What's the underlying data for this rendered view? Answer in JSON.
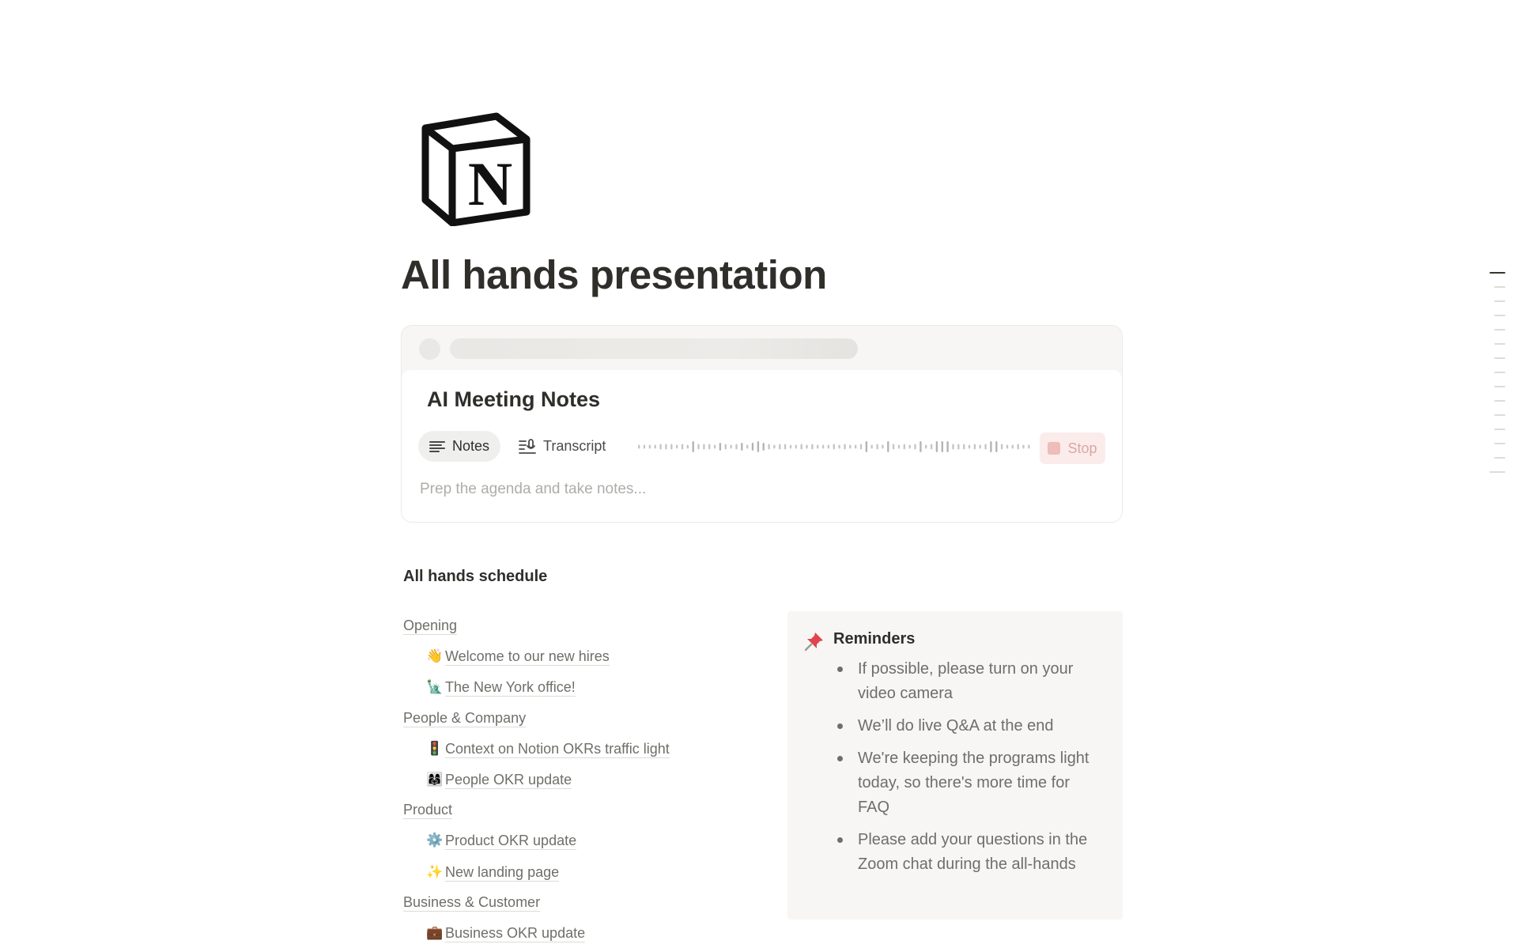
{
  "page": {
    "title": "All hands presentation",
    "icon": "notion-logo-icon"
  },
  "ai_notes": {
    "title": "AI Meeting Notes",
    "tabs": [
      {
        "label": "Notes",
        "icon": "notes-lines-icon",
        "selected": true
      },
      {
        "label": "Transcript",
        "icon": "transcript-icon",
        "selected": false
      }
    ],
    "stop_label": "Stop",
    "notes_placeholder": "Prep the agenda and take notes..."
  },
  "schedule": {
    "heading": "All hands schedule",
    "sections": [
      {
        "label": "Opening",
        "items": [
          {
            "emoji": "👋",
            "label": "Welcome to our new hires"
          },
          {
            "emoji": "🗽",
            "label": "The New York office!"
          }
        ]
      },
      {
        "label": "People & Company",
        "items": [
          {
            "emoji": "🚦",
            "label": "Context on Notion OKRs traffic light"
          },
          {
            "emoji": "👩‍👩‍👧",
            "label": "People OKR update"
          }
        ]
      },
      {
        "label": "Product",
        "items": [
          {
            "emoji": "⚙️",
            "label": "Product OKR update"
          },
          {
            "emoji": "✨",
            "label": "New landing page"
          }
        ]
      },
      {
        "label": "Business & Customer",
        "items": [
          {
            "emoji": "💼",
            "label": "Business OKR update"
          }
        ]
      }
    ]
  },
  "reminders": {
    "title": "Reminders",
    "icon": "pushpin-icon",
    "items": [
      "If possible, please turn on your video camera",
      "We’ll do live Q&A at the end",
      "We're keeping the programs light today, so there's more time for FAQ",
      "Please add your questions in the Zoom chat during the all-hands"
    ]
  },
  "colors": {
    "text": "#37352f",
    "muted": "#6f6e69",
    "callout_bg": "#f7f6f4",
    "stop_bg": "#fbeceb",
    "stop_text": "#d9a7a4"
  }
}
